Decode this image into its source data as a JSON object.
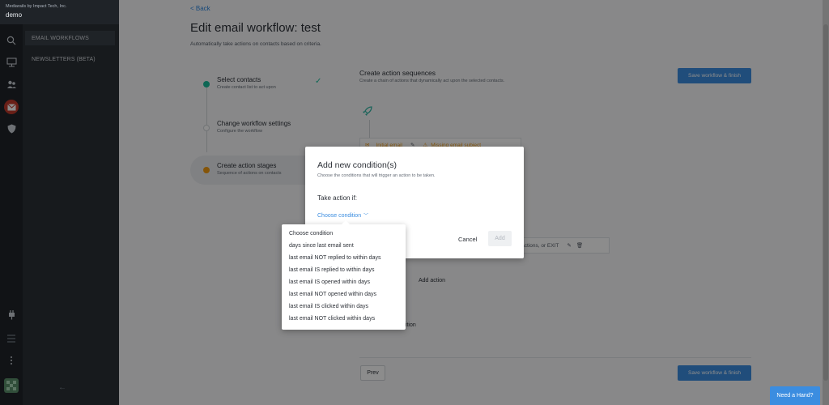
{
  "org": {
    "company": "Mediarails by Impact Tech, Inc.",
    "account": "demo"
  },
  "sidebar": {
    "items": [
      {
        "label": "EMAIL WORKFLOWS",
        "selected": true
      },
      {
        "label": "NEWSLETTERS (BETA)",
        "selected": false
      }
    ],
    "collapse_icon": "arrow-left-icon"
  },
  "rail_icons": [
    "search-icon",
    "dashboard-icon",
    "contacts-icon",
    "email-icon",
    "shield-icon",
    "plug-icon",
    "list-icon",
    "more-icon",
    "avatar"
  ],
  "page": {
    "back_label": "< Back",
    "title": "Edit email workflow: test",
    "subtitle": "Automatically take actions on contacts based on criteria."
  },
  "steps": [
    {
      "name": "Select contacts",
      "desc": "Create contact list to act upon",
      "status": "done"
    },
    {
      "name": "Change workflow settings",
      "desc": "Configure the workflow",
      "status": "pending"
    },
    {
      "name": "Create action stages",
      "desc": "Sequence of actions on contacts",
      "status": "current"
    }
  ],
  "sequence": {
    "heading": "Create action sequences",
    "subheading": "Create a chain of actions that dynamically act upon the selected contacts.",
    "save_label": "Save workflow & finish",
    "initial_email_label": "Initial email",
    "missing_subject_label": "Missing email subject",
    "follow_label": "ow actions, or EXIT",
    "add_action_label": "Add action",
    "add_condition_label": "dition",
    "prev_label": "Prev"
  },
  "modal": {
    "title": "Add new condition(s)",
    "subtitle": "Choose the conditions that will trigger an action to be taken.",
    "take_action_label": "Take action if:",
    "choose_label": "Choose condition",
    "cancel_label": "Cancel",
    "add_label": "Add"
  },
  "dropdown": {
    "options": [
      "Choose condition",
      "days since last email sent",
      "last email NOT replied to within days",
      "last email IS replied to within days",
      "last email IS opened within days",
      "last email NOT opened within days",
      "last email IS clicked within days",
      "last email NOT clicked within days"
    ]
  },
  "help": {
    "label": "Need a Hand?"
  },
  "colors": {
    "primary": "#3b8de0",
    "success": "#1abc9c",
    "warning": "#f39c12",
    "dark": "#1f2328"
  }
}
